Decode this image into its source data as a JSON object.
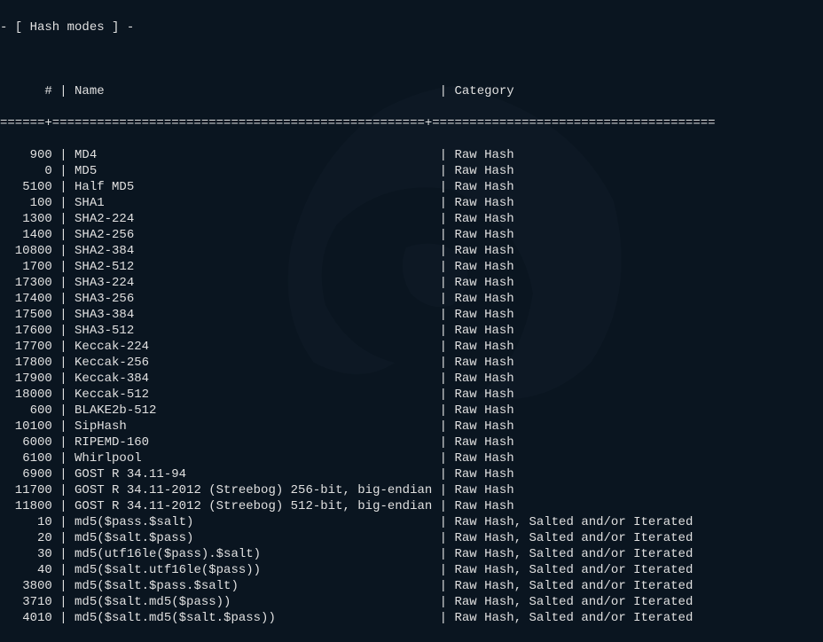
{
  "header": {
    "title": "- [ Hash modes ] -",
    "col_id": "#",
    "col_name": "Name",
    "col_category": "Category",
    "separator": "======+==================================================+======================================"
  },
  "rows": [
    {
      "id": "900",
      "name": "MD4",
      "category": "Raw Hash"
    },
    {
      "id": "0",
      "name": "MD5",
      "category": "Raw Hash"
    },
    {
      "id": "5100",
      "name": "Half MD5",
      "category": "Raw Hash"
    },
    {
      "id": "100",
      "name": "SHA1",
      "category": "Raw Hash"
    },
    {
      "id": "1300",
      "name": "SHA2-224",
      "category": "Raw Hash"
    },
    {
      "id": "1400",
      "name": "SHA2-256",
      "category": "Raw Hash"
    },
    {
      "id": "10800",
      "name": "SHA2-384",
      "category": "Raw Hash"
    },
    {
      "id": "1700",
      "name": "SHA2-512",
      "category": "Raw Hash"
    },
    {
      "id": "17300",
      "name": "SHA3-224",
      "category": "Raw Hash"
    },
    {
      "id": "17400",
      "name": "SHA3-256",
      "category": "Raw Hash"
    },
    {
      "id": "17500",
      "name": "SHA3-384",
      "category": "Raw Hash"
    },
    {
      "id": "17600",
      "name": "SHA3-512",
      "category": "Raw Hash"
    },
    {
      "id": "17700",
      "name": "Keccak-224",
      "category": "Raw Hash"
    },
    {
      "id": "17800",
      "name": "Keccak-256",
      "category": "Raw Hash"
    },
    {
      "id": "17900",
      "name": "Keccak-384",
      "category": "Raw Hash"
    },
    {
      "id": "18000",
      "name": "Keccak-512",
      "category": "Raw Hash"
    },
    {
      "id": "600",
      "name": "BLAKE2b-512",
      "category": "Raw Hash"
    },
    {
      "id": "10100",
      "name": "SipHash",
      "category": "Raw Hash"
    },
    {
      "id": "6000",
      "name": "RIPEMD-160",
      "category": "Raw Hash"
    },
    {
      "id": "6100",
      "name": "Whirlpool",
      "category": "Raw Hash"
    },
    {
      "id": "6900",
      "name": "GOST R 34.11-94",
      "category": "Raw Hash"
    },
    {
      "id": "11700",
      "name": "GOST R 34.11-2012 (Streebog) 256-bit, big-endian",
      "category": "Raw Hash"
    },
    {
      "id": "11800",
      "name": "GOST R 34.11-2012 (Streebog) 512-bit, big-endian",
      "category": "Raw Hash"
    },
    {
      "id": "10",
      "name": "md5($pass.$salt)",
      "category": "Raw Hash, Salted and/or Iterated"
    },
    {
      "id": "20",
      "name": "md5($salt.$pass)",
      "category": "Raw Hash, Salted and/or Iterated"
    },
    {
      "id": "30",
      "name": "md5(utf16le($pass).$salt)",
      "category": "Raw Hash, Salted and/or Iterated"
    },
    {
      "id": "40",
      "name": "md5($salt.utf16le($pass))",
      "category": "Raw Hash, Salted and/or Iterated"
    },
    {
      "id": "3800",
      "name": "md5($salt.$pass.$salt)",
      "category": "Raw Hash, Salted and/or Iterated"
    },
    {
      "id": "3710",
      "name": "md5($salt.md5($pass))",
      "category": "Raw Hash, Salted and/or Iterated"
    },
    {
      "id": "4010",
      "name": "md5($salt.md5($salt.$pass))",
      "category": "Raw Hash, Salted and/or Iterated"
    }
  ]
}
